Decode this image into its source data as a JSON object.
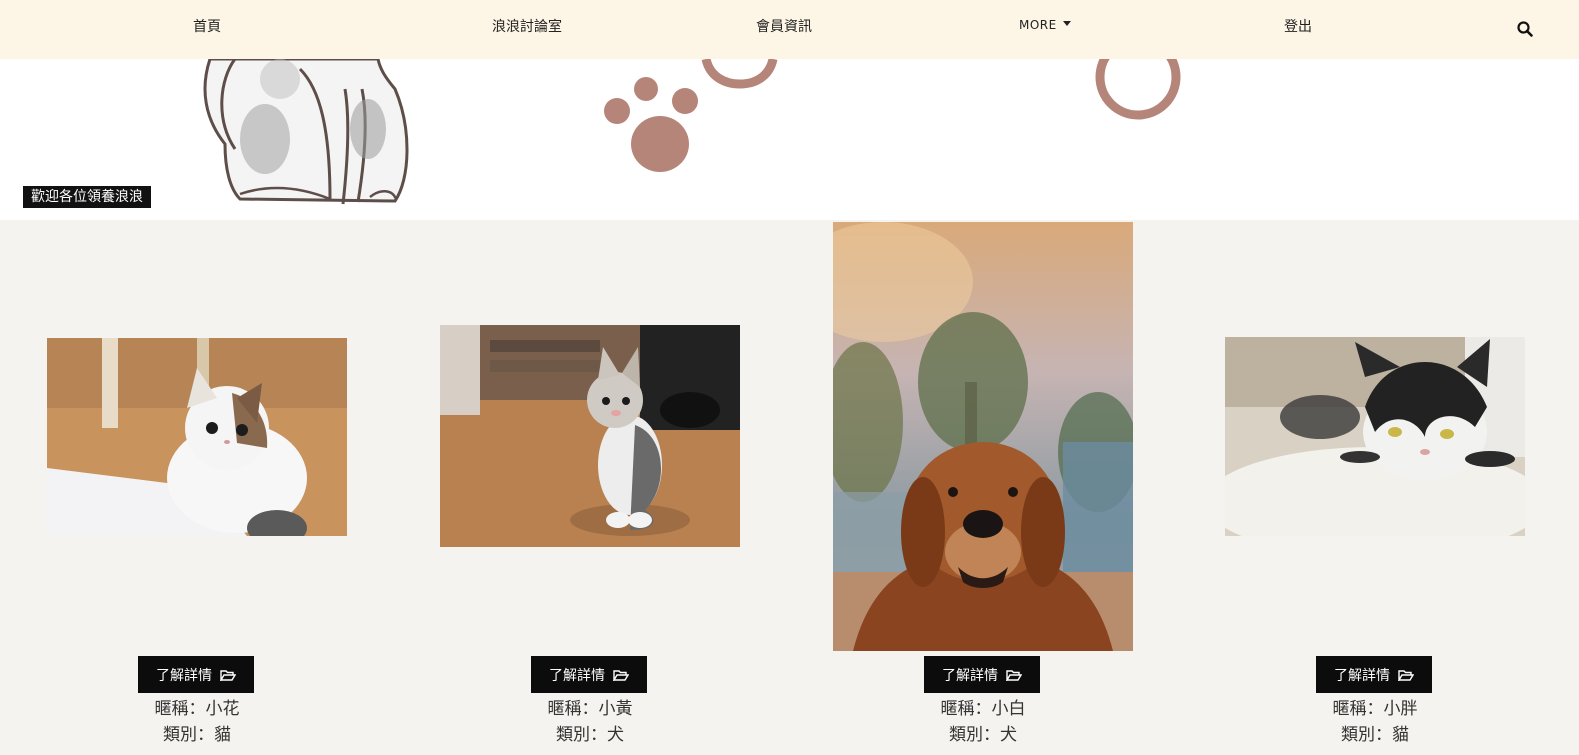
{
  "nav": {
    "items": [
      {
        "label": "首頁"
      },
      {
        "label": "浪浪討論室"
      },
      {
        "label": "會員資訊"
      },
      {
        "label": "MORE"
      },
      {
        "label": "登出"
      }
    ],
    "search_icon": "search-icon",
    "background": "#fdf5e5"
  },
  "banner": {
    "welcome": "歡迎各位領養浪浪",
    "accent": "#b5857a"
  },
  "pets": [
    {
      "photo": "calico-kitten",
      "button": "了解詳情",
      "name": "暱稱：小花",
      "type": "類別：貓"
    },
    {
      "photo": "tabby-kitten",
      "button": "了解詳情",
      "name": "暱稱：小黃",
      "type": "類別：犬"
    },
    {
      "photo": "golden-retriever",
      "button": "了解詳情",
      "name": "暱稱：小白",
      "type": "類別：犬"
    },
    {
      "photo": "tuxedo-cat",
      "button": "了解詳情",
      "name": "暱稱：小胖",
      "type": "類別：貓"
    }
  ],
  "icons": {
    "button": "folder-open-icon"
  }
}
